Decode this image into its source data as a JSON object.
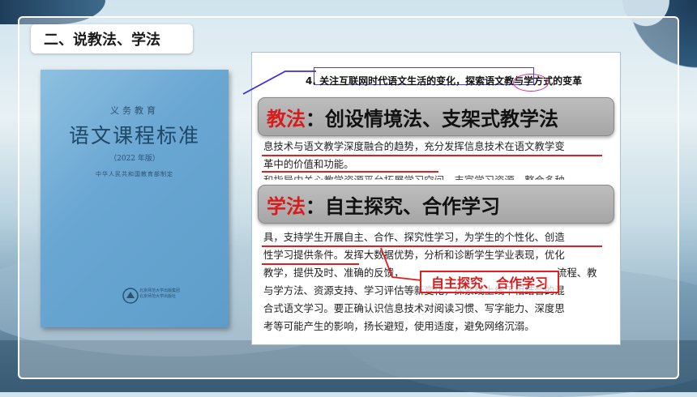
{
  "slide": {
    "section_title": "二、说教法、学法"
  },
  "book": {
    "series": "义务教育",
    "title": "语文课程标准",
    "edition": "（2022 年版）",
    "ministry": "中华人民共和国教育部制定",
    "publisher_line1": "北京师范大学出版集团",
    "publisher_line2": "北京师范大学出版社"
  },
  "document": {
    "heading": "4. 关注互联网时代语文生活的变化，探索语文教与学方式的变革",
    "lines": [
      "息技术与语文教学深度融合的趋势，充分发挥信息技术在语文教学变",
      "革中的价值和功能。",
      "具，支持学生开展自主、合作、探究性学习，为学生的个性化、创造",
      "性学习提供条件。发挥大数据优势，分析和诊断学生学业表现，优化",
      "教学，提供及时、准确的反馈，",
      "与学方法、资源支持、学习评估等新变化，探索线上线下相结合的混",
      "合式语文学习。要正确认识信息技术对阅读习惯、写字能力、深度思",
      "考等可能产生的影响，扬长避短，使用适度，避免网络沉溺。"
    ],
    "partial_line": "和指导中关心教学资源平台拓展学习空间，丰富学习资源，整合多种",
    "partial_right": "流程、教"
  },
  "callouts": {
    "teaching": {
      "label": "教法",
      "sep": "：",
      "text": "创设情境法、支架式教学法"
    },
    "learning": {
      "label": "学法",
      "sep": "：",
      "text": "自主探究、合作学习"
    },
    "highlight": "自主探究、合作学习"
  },
  "colors": {
    "accent_red": "#d81b1b",
    "box_blue": "#4b3de0",
    "circle_magenta": "#d2288c"
  }
}
